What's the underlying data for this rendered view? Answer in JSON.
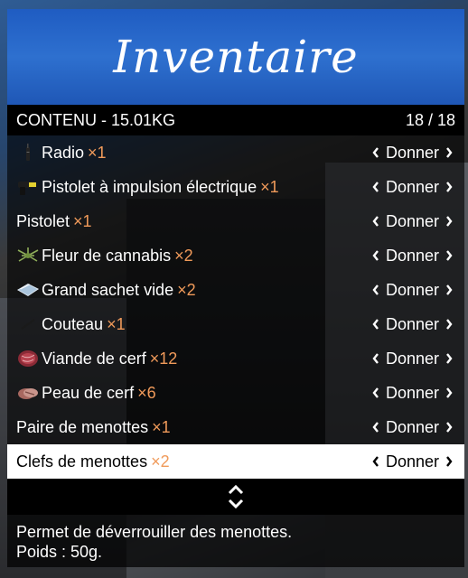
{
  "menu": {
    "title": "Inventaire",
    "subtitle_left": "CONTENU - 15.01KG",
    "subtitle_right": "18 / 18",
    "items": [
      {
        "label": "Radio",
        "qty": "×1",
        "action": "Donner",
        "icon": "radio-icon"
      },
      {
        "label": "Pistolet à impulsion électrique",
        "qty": "×1",
        "action": "Donner",
        "icon": "taser-icon"
      },
      {
        "label": "Pistolet",
        "qty": "×1",
        "action": "Donner",
        "icon": ""
      },
      {
        "label": "Fleur de cannabis",
        "qty": "×2",
        "action": "Donner",
        "icon": "cannabis-icon"
      },
      {
        "label": "Grand sachet vide",
        "qty": "×2",
        "action": "Donner",
        "icon": "bag-icon"
      },
      {
        "label": "Couteau",
        "qty": "×1",
        "action": "Donner",
        "icon": "knife-icon"
      },
      {
        "label": "Viande de cerf",
        "qty": "×12",
        "action": "Donner",
        "icon": "meat-icon"
      },
      {
        "label": "Peau de cerf",
        "qty": "×6",
        "action": "Donner",
        "icon": "hide-icon"
      },
      {
        "label": "Paire de menottes",
        "qty": "×1",
        "action": "Donner",
        "icon": ""
      },
      {
        "label": "Clefs de menottes",
        "qty": "×2",
        "action": "Donner",
        "icon": ""
      }
    ],
    "description_line1": "Permet de déverrouiller des menottes.",
    "description_line2": "Poids : 50g."
  },
  "colors": {
    "banner": "#2e70cf",
    "quantity": "#f09a5a",
    "selected_bg": "#ffffff"
  }
}
